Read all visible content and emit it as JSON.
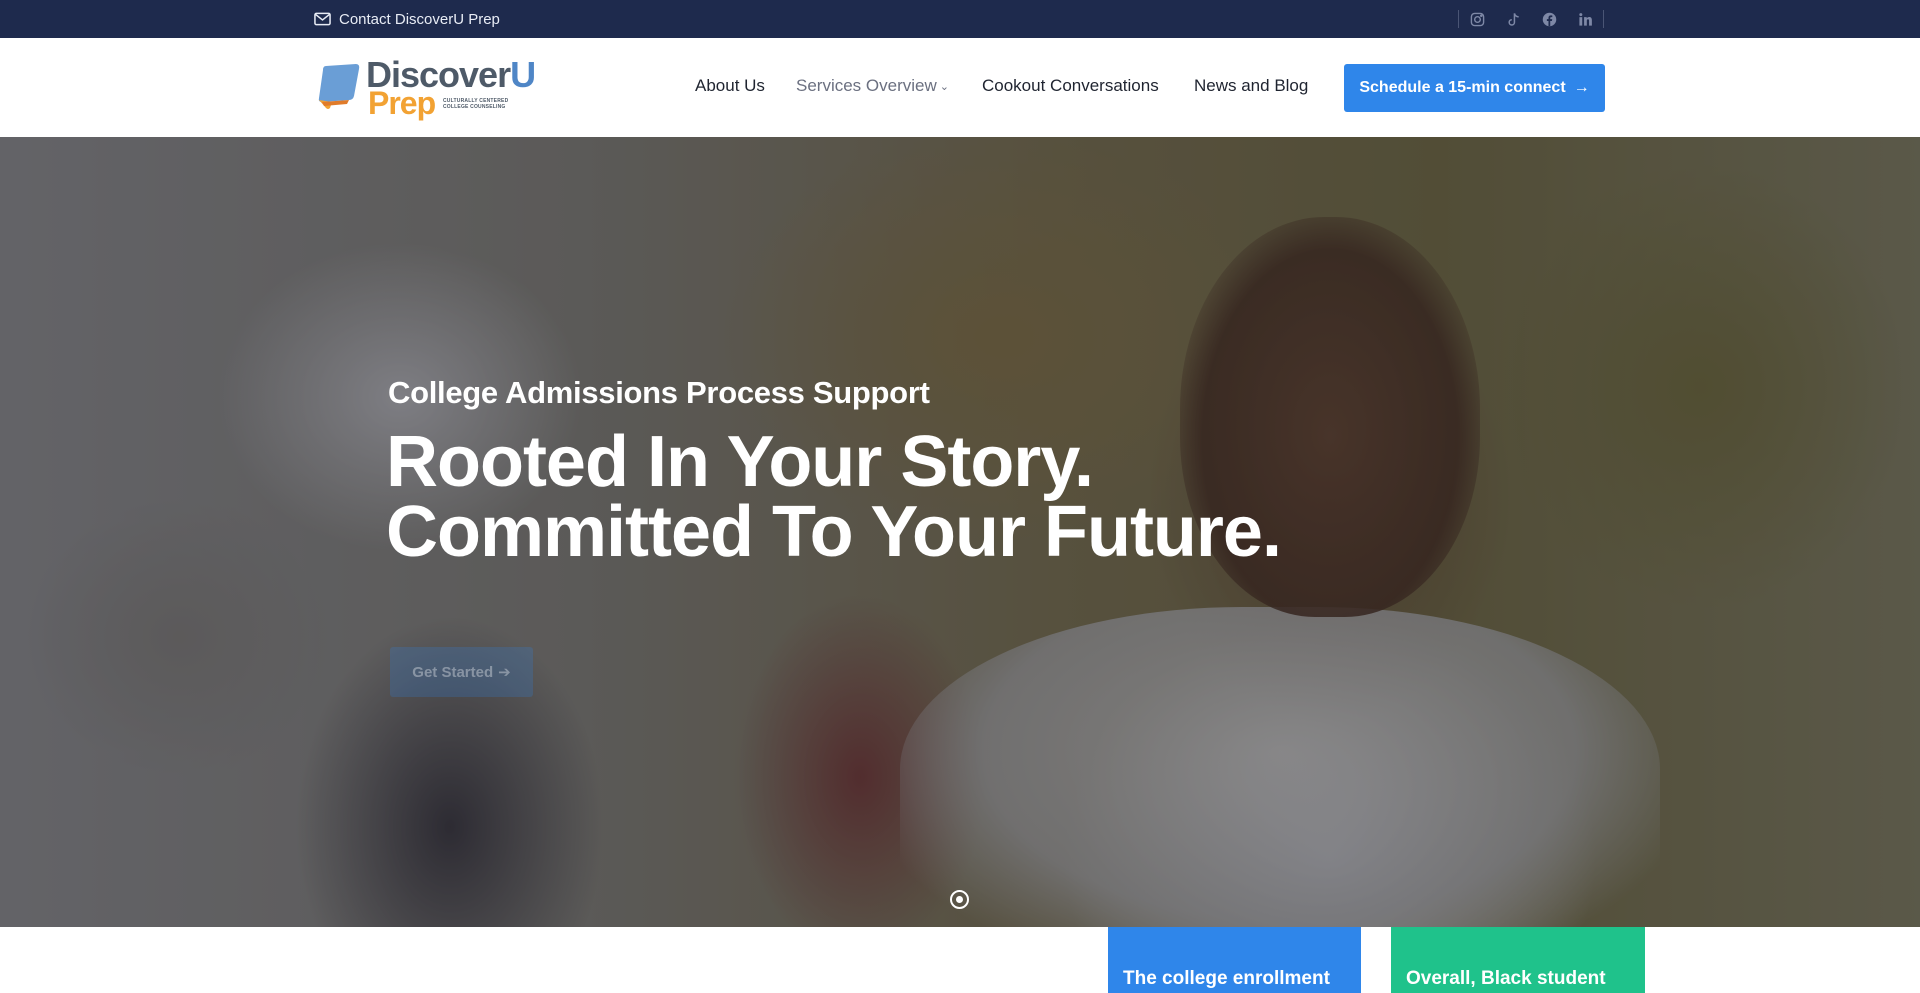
{
  "topbar": {
    "contact_label": "Contact DiscoverU Prep",
    "contact_icon": "envelope-icon",
    "socials": [
      {
        "name": "instagram-icon"
      },
      {
        "name": "tiktok-icon"
      },
      {
        "name": "facebook-icon"
      },
      {
        "name": "linkedin-icon"
      }
    ]
  },
  "logo": {
    "word1_a": "Discover",
    "word1_b": "U",
    "word2": "Prep",
    "tagline_1": "CULTURALLY CENTERED",
    "tagline_2": "COLLEGE COUNSELING"
  },
  "nav": {
    "items": [
      {
        "label": "About Us"
      },
      {
        "label": "Services Overview"
      },
      {
        "label": "Cookout Conversations"
      },
      {
        "label": "News and Blog"
      }
    ],
    "cta_label": "Schedule a 15-min connect",
    "cta_arrow": "→"
  },
  "hero": {
    "eyebrow": "College Admissions Process Support",
    "headline_line1": "Rooted In Your Story.",
    "headline_line2": "Committed To Your Future.",
    "button_label": "Get Started",
    "button_arrow": "➔"
  },
  "cards": [
    {
      "text": "The college enrollment",
      "color": "#2f86ea"
    },
    {
      "text": "Overall, Black student",
      "color": "#1fc28b"
    }
  ],
  "colors": {
    "topbar_bg": "#1e2a4d",
    "accent_blue": "#2f86ea",
    "accent_green": "#1fc28b",
    "logo_orange": "#f2a233"
  }
}
